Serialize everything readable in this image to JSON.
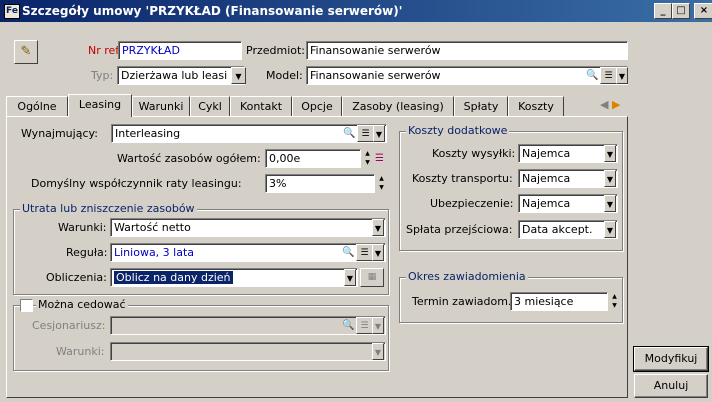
{
  "window": {
    "title": "Szczegóły umowy 'PRZYKŁAD (Finansowanie serwerów)'",
    "controls": {
      "minimize": "_",
      "maximize": "□",
      "close": "×"
    }
  },
  "header": {
    "ref_label": "Nr ref.:",
    "ref_value": "PRZYKŁAD",
    "subject_label": "Przedmiot:",
    "subject_value": "Finansowanie serwerów",
    "type_label": "Typ:",
    "type_value": "Dzierżawa lub leasi",
    "model_label": "Model:",
    "model_value": "Finansowanie serwerów"
  },
  "tabs": [
    "Ogólne",
    "Leasing",
    "Warunki",
    "Cykl",
    "Kontakt",
    "Opcje",
    "Zasoby (leasing)",
    "Spłaty",
    "Koszty"
  ],
  "active_tab": "Leasing",
  "leasing": {
    "lessor_label": "Wynajmujący:",
    "lessor_value": "Interleasing",
    "total_value_label": "Wartość zasobów ogółem:",
    "total_value": "0,00e",
    "rate_label": "Domyślny współczynnik raty leasingu:",
    "rate_value": "3%"
  },
  "loss_group": {
    "title": "Utrata lub zniszczenie zasobów",
    "conditions_label": "Warunki:",
    "conditions_value": "Wartość netto",
    "rule_label": "Reguła:",
    "rule_value": "Liniowa, 3 lata",
    "calc_label": "Obliczenia:",
    "calc_value": "Oblicz na dany dzień"
  },
  "assign_group": {
    "checkbox_label": "Można cedować",
    "assignee_label": "Cesjonariusz:",
    "assignee_value": "",
    "conditions_label": "Warunki:",
    "conditions_value": ""
  },
  "costs_group": {
    "title": "Koszty dodatkowe",
    "shipping_label": "Koszty wysyłki:",
    "shipping_value": "Najemca",
    "transport_label": "Koszty transportu:",
    "transport_value": "Najemca",
    "insurance_label": "Ubezpieczenie:",
    "insurance_value": "Najemca",
    "transitional_label": "Spłata przejściowa:",
    "transitional_value": "Data akcept."
  },
  "notice_group": {
    "title": "Okres zawiadomienia",
    "notice_label": "Termin zawiadom.:",
    "notice_value": "3 miesiące"
  },
  "buttons": {
    "modify": "Modyfikuj",
    "cancel": "Anuluj"
  }
}
